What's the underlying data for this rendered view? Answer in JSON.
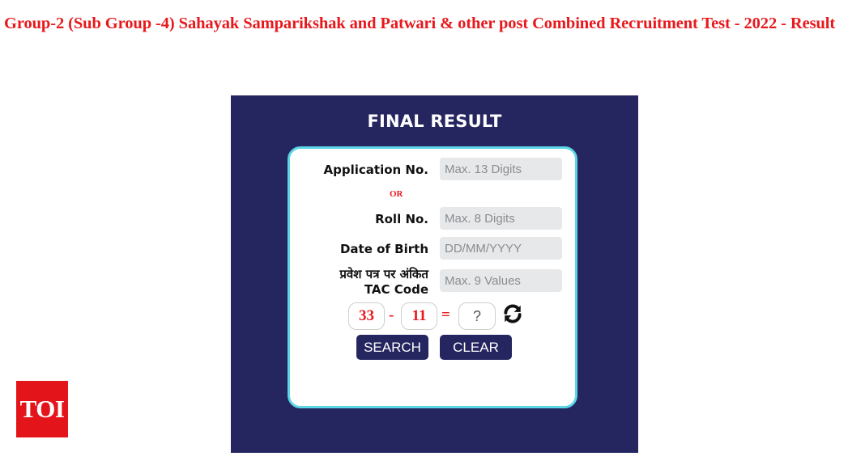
{
  "page": {
    "title": "Group-2 (Sub Group -4) Sahayak Samparikshak and Patwari & other post Combined Recruitment Test - 2022 - Result"
  },
  "panel": {
    "heading": "FINAL RESULT"
  },
  "form": {
    "application_no": {
      "label": "Application No.",
      "placeholder": "Max. 13 Digits",
      "value": ""
    },
    "or_text": "OR",
    "roll_no": {
      "label": "Roll No.",
      "placeholder": "Max. 8 Digits",
      "value": ""
    },
    "dob": {
      "label": "Date of Birth",
      "placeholder": "DD/MM/YYYY",
      "value": ""
    },
    "tac": {
      "label_line1": "प्रवेश पत्र पर अंकित",
      "label_line2": "TAC Code",
      "placeholder": "Max. 9 Values",
      "value": ""
    },
    "captcha": {
      "operand1": "33",
      "operator": "-",
      "operand2": "11",
      "equals": "=",
      "answer_placeholder": "?",
      "refresh_icon": "refresh-icon"
    },
    "buttons": {
      "search": "SEARCH",
      "clear": "CLEAR"
    }
  },
  "logo": {
    "text": "TOI"
  },
  "colors": {
    "title": "#e8191d",
    "panel": "#252660",
    "form_border": "#5bd6e6",
    "captcha_text": "#e8191d",
    "logo_bg": "#e4141b"
  }
}
